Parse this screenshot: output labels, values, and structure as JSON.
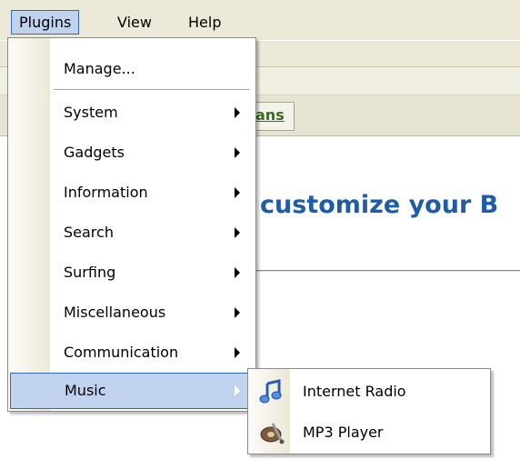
{
  "menubar": {
    "items": [
      {
        "label": "Plugins",
        "active": true
      },
      {
        "label": "View",
        "active": false
      },
      {
        "label": "Help",
        "active": false
      }
    ]
  },
  "background": {
    "tab_label": "ans",
    "heading": "customize your B"
  },
  "plugins_menu": {
    "items": [
      {
        "label": "Manage...",
        "submenu": false
      },
      {
        "label": "System",
        "submenu": true
      },
      {
        "label": "Gadgets",
        "submenu": true
      },
      {
        "label": "Information",
        "submenu": true
      },
      {
        "label": "Search",
        "submenu": true
      },
      {
        "label": "Surfing",
        "submenu": true
      },
      {
        "label": "Miscellaneous",
        "submenu": true
      },
      {
        "label": "Communication",
        "submenu": true
      },
      {
        "label": "Music",
        "submenu": true,
        "highlighted": true
      }
    ]
  },
  "music_submenu": {
    "items": [
      {
        "label": "Internet Radio",
        "icon": "music-note-icon"
      },
      {
        "label": "MP3 Player",
        "icon": "mp3-player-icon"
      }
    ]
  },
  "colors": {
    "menu_bar_bg": "#ece9d8",
    "highlight_bg": "#c1d2ee",
    "highlight_border": "#316ac5",
    "heading_blue": "#1e5ba8",
    "tab_green": "#3a6d1f"
  }
}
